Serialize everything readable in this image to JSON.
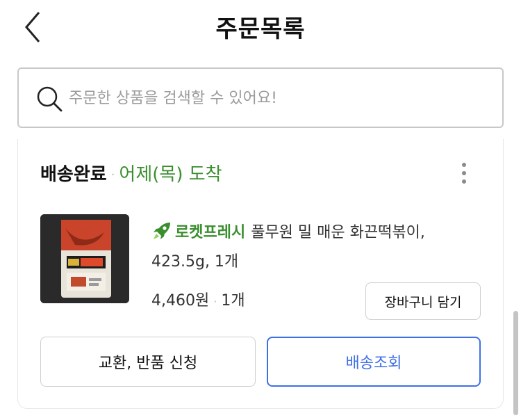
{
  "header": {
    "title": "주문목록",
    "back_icon": "chevron-left-icon"
  },
  "search": {
    "placeholder": "주문한 상품을 검색할 수 있어요!",
    "icon": "search-icon"
  },
  "order": {
    "status": "배송완료",
    "delivery_date": "어제(목) 도착",
    "menu_icon": "more-vertical-icon",
    "product": {
      "badge": "로켓프레시",
      "badge_icon": "rocket-icon",
      "name": "풀무원 밀 매운 화끈떡볶이,",
      "option": "423.5g, 1개",
      "price": "4,460원",
      "quantity": "1개"
    },
    "cart_button": "장바구니 담기",
    "exchange_button": "교환, 반품 신청",
    "tracking_button": "배송조회"
  },
  "colors": {
    "accent_green": "#3a8e2e",
    "accent_blue": "#3f6fe6"
  }
}
